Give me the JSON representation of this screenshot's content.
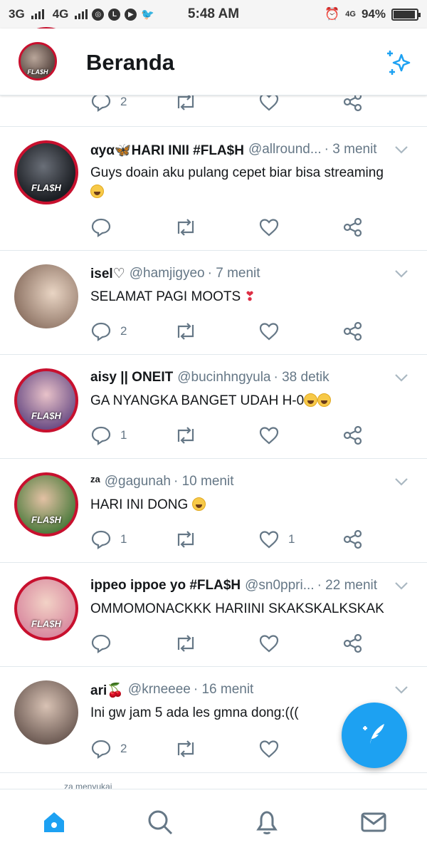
{
  "status_bar": {
    "network_1": "3G",
    "network_2": "4G",
    "time": "5:48 AM",
    "network_3": "4G",
    "battery": "94%",
    "battery_level": 0.94
  },
  "header": {
    "title": "Beranda",
    "avatar_tag": "FLA$H"
  },
  "tweets": [
    {
      "name": "",
      "handle": "",
      "time": "",
      "text": "",
      "reply_count": "2",
      "like_count": ""
    },
    {
      "name": "αyα🦋HARI INII #FLA$H",
      "handle": "@allround...",
      "time": "· 3 menit",
      "text": "Guys doain aku pulang cepet biar bisa streaming",
      "reply_count": "",
      "like_count": "",
      "avatar_tag": "FLA$H"
    },
    {
      "name": "isel♡",
      "handle": "@hamjigyeo",
      "time": "· 7 menit",
      "text": "SELAMAT PAGI MOOTS",
      "reply_count": "2",
      "like_count": ""
    },
    {
      "name": "aisy || ONEIT",
      "handle": "@bucinhngyula",
      "time": "· 38 detik",
      "text": "GA NYANGKA BANGET UDAH H-0",
      "reply_count": "1",
      "like_count": "",
      "avatar_tag": "FLA$H"
    },
    {
      "name": "za",
      "handle": "@gagunah",
      "time": "· 10 menit",
      "text": "HARI INI DONG",
      "reply_count": "1",
      "like_count": "1",
      "avatar_tag": "FLA$H"
    },
    {
      "name": "ippeo ippoe yo #FLA$H",
      "handle": "@sn0ppri...",
      "time": "· 22 menit",
      "text": "OMMOMONACKKK HARIINI SKAKSKALKSKAK",
      "reply_count": "",
      "like_count": "",
      "avatar_tag": "FLA$H"
    },
    {
      "name": "ari🍒",
      "handle": "@krneeee",
      "time": "· 16 menit",
      "text": "Ini gw jam 5 ada les gmna dong:(((",
      "reply_count": "2",
      "like_count": ""
    }
  ],
  "peek_text": "za menyukai",
  "icons": {
    "compose": "compose-tweet-icon",
    "sparkle": "sparkle-icon",
    "home": "home-icon",
    "search": "search-icon",
    "notifications": "bell-icon",
    "messages": "mail-icon"
  },
  "colors": {
    "accent": "#1da1f2",
    "text": "#14171a",
    "muted": "#657786",
    "flash_ring": "#c8102e"
  }
}
